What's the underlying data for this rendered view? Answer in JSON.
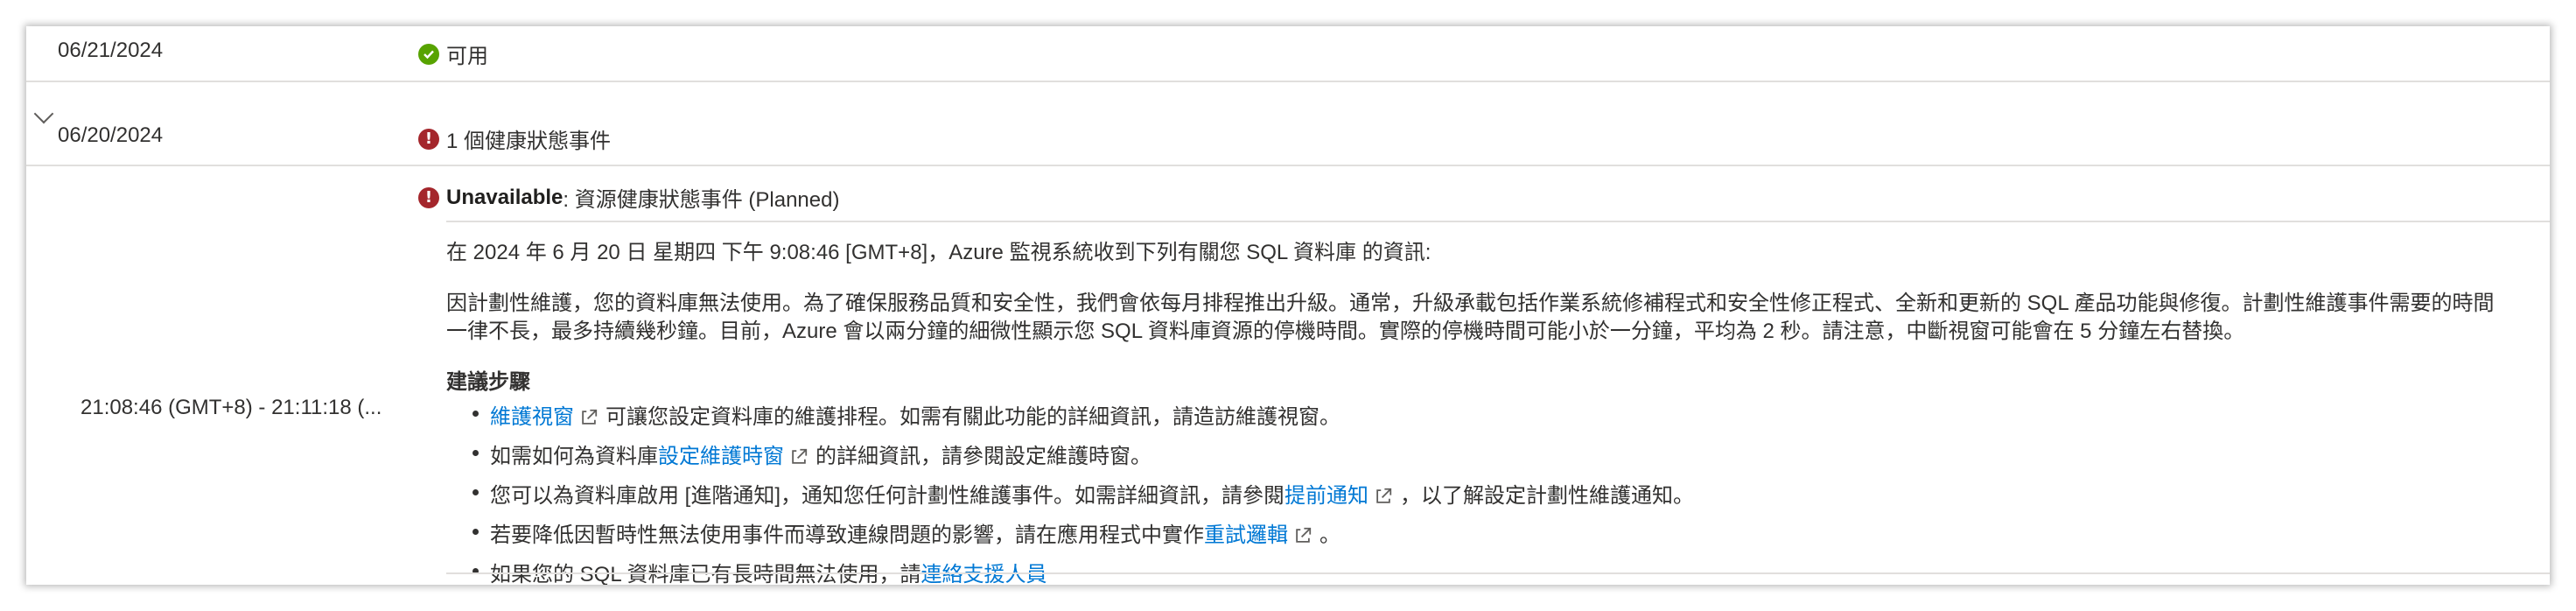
{
  "rows": [
    {
      "date": "06/21/2024",
      "status": "可用",
      "status_icon": "check-circle-icon"
    },
    {
      "date": "06/20/2024",
      "status": "1 個健康狀態事件",
      "status_icon": "error-circle-icon",
      "expanded": true
    }
  ],
  "event": {
    "time_range": "21:08:46 (GMT+8) - 21:11:18 (...",
    "title_bold": "Unavailable",
    "title_rest": " : 資源健康狀態事件 (Planned)",
    "intro": "在 2024 年 6 月 20 日 星期四 下午 9:08:46 [GMT+8]，Azure 監視系統收到下列有關您 SQL 資料庫 的資訊:",
    "body_line1": "因計劃性維護，您的資料庫無法使用。為了確保服務品質和安全性，我們會依每月排程推出升級。通常，升級承載包括作業系統修補程式和安全性修正程式、全新和更新的 SQL 產品功能與修復。計劃性維護事件需要的時間",
    "body_line2": "一律不長，最多持續幾秒鐘。目前，Azure 會以兩分鐘的細微性顯示您 SQL 資料庫資源的停機時間。實際的停機時間可能小於一分鐘，平均為 2 秒。請注意，中斷視窗可能會在 5 分鐘左右替換。",
    "steps_heading": "建議步驟",
    "steps": [
      {
        "pre": "",
        "link": "維護視窗",
        "post": "可讓您設定資料庫的維護排程。如需有關此功能的詳細資訊，請造訪維護視窗。"
      },
      {
        "pre": "如需如何為資料庫 ",
        "link": "設定維護時窗",
        "post": "的詳細資訊，請參閱設定維護時窗。"
      },
      {
        "pre": "您可以為資料庫啟用 [進階通知]，通知您任何計劃性維護事件。如需詳細資訊，請參閱 ",
        "link": "提前通知",
        "post": "，以了解設定計劃性維護通知。"
      },
      {
        "pre": "若要降低因暫時性無法使用事件而導致連線問題的影響，請在應用程式中實作 ",
        "link": "重試邏輯",
        "post": "。"
      },
      {
        "pre": "如果您的 SQL 資料庫已有長時間無法使用，請 ",
        "link": "連絡支援人員",
        "post": ""
      }
    ]
  },
  "colors": {
    "ok": "#57a300",
    "error": "#a4262c",
    "link": "#0078d4",
    "divider": "#e1dfdd"
  }
}
